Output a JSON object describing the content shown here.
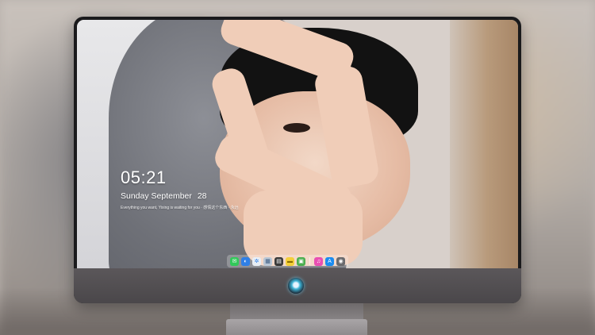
{
  "lock_screen": {
    "time": "05:21",
    "weekday_month": "Sunday September",
    "day": "28",
    "quote": "Everything you want, Yixing is waiting for you · 感情这个东西 · 永远"
  },
  "dock": {
    "items": [
      {
        "name": "messages-icon",
        "glyph": "✉",
        "color": "#32c95a"
      },
      {
        "name": "finder-icon",
        "glyph": "◐",
        "color": "#2f7fe6"
      },
      {
        "name": "safari-icon",
        "glyph": "✲",
        "color": "#e8eef5"
      },
      {
        "name": "preview-icon",
        "glyph": "▦",
        "color": "#b9c7d6"
      },
      {
        "name": "clapper-icon",
        "glyph": "▤",
        "color": "#3a3a3a"
      },
      {
        "name": "notes-icon",
        "glyph": "▬",
        "color": "#f4cf3a"
      },
      {
        "name": "photos-icon",
        "glyph": "▣",
        "color": "#4caf50"
      },
      {
        "name": "music-icon",
        "glyph": "♫",
        "color": "#e94fb3"
      },
      {
        "name": "app-store-icon",
        "glyph": "A",
        "color": "#1b8cf0"
      },
      {
        "name": "camera-icon",
        "glyph": "◉",
        "color": "#6b6b6e"
      }
    ]
  }
}
